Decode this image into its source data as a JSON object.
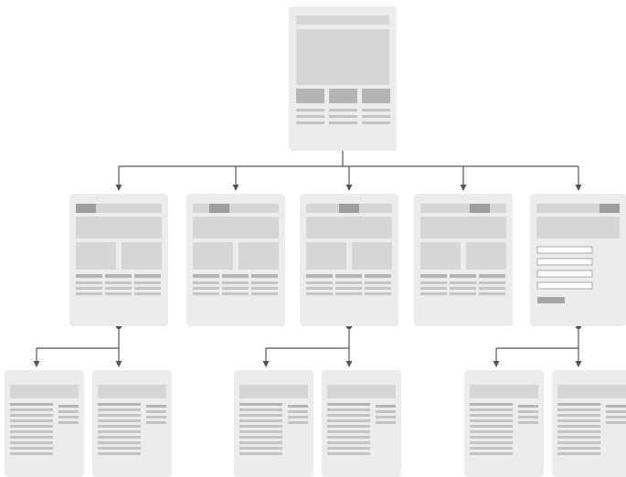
{
  "diagram": {
    "type": "website-sitemap-wireframe",
    "colors": {
      "page": "#ececec",
      "block": "#d6d6d6",
      "line": "#c4c4c4",
      "dark": "#9d9d9d",
      "connector": "#555555",
      "field": "#ffffff",
      "field_border": "#a8a8a8"
    },
    "pages": [
      {
        "id": "home",
        "level": 0,
        "template": "home"
      },
      {
        "id": "section-1",
        "level": 1,
        "template": "section",
        "active_tab": 0,
        "parent": "home"
      },
      {
        "id": "section-2",
        "level": 1,
        "template": "section",
        "active_tab": 1,
        "parent": "home"
      },
      {
        "id": "section-3",
        "level": 1,
        "template": "section",
        "active_tab": 2,
        "parent": "home"
      },
      {
        "id": "section-4",
        "level": 1,
        "template": "section",
        "active_tab": 3,
        "parent": "home"
      },
      {
        "id": "contact",
        "level": 1,
        "template": "form",
        "active_tab": 4,
        "form_fields": 4,
        "parent": "home"
      },
      {
        "id": "section-1-sub-1",
        "level": 2,
        "template": "article",
        "parent": "section-1"
      },
      {
        "id": "section-1-sub-2",
        "level": 2,
        "template": "article",
        "parent": "section-1"
      },
      {
        "id": "section-3-sub-1",
        "level": 2,
        "template": "article",
        "parent": "section-3"
      },
      {
        "id": "section-3-sub-2",
        "level": 2,
        "template": "article",
        "parent": "section-3"
      },
      {
        "id": "contact-sub-1",
        "level": 2,
        "template": "article",
        "parent": "contact"
      },
      {
        "id": "contact-sub-2",
        "level": 2,
        "template": "article",
        "parent": "contact"
      }
    ]
  }
}
